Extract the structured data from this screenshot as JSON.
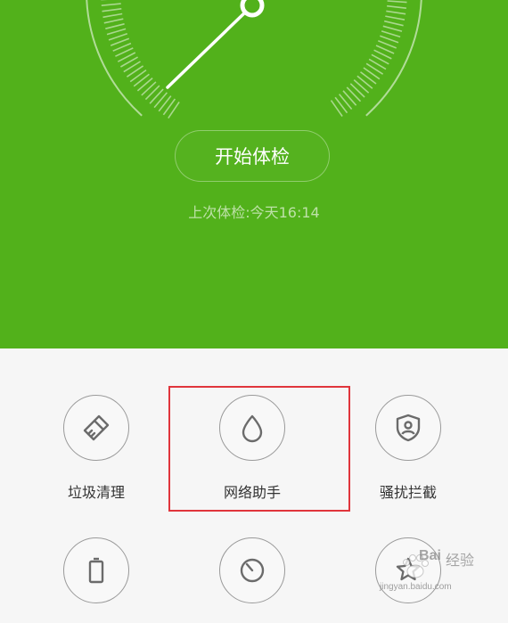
{
  "health_check": {
    "start_button_label": "开始体检",
    "last_check_text": "上次体检:今天16:14"
  },
  "colors": {
    "hero_green": "#52b11b",
    "highlight_red": "#e0353c",
    "tool_icon_gray": "#6b6b6b"
  },
  "tools": [
    {
      "label": "垃圾清理",
      "icon": "broom-icon"
    },
    {
      "label": "网络助手",
      "icon": "droplet-icon"
    },
    {
      "label": "骚扰拦截",
      "icon": "shield-user-icon"
    },
    {
      "label": "",
      "icon": "battery-icon"
    },
    {
      "label": "",
      "icon": "timer-icon"
    },
    {
      "label": "",
      "icon": "star-icon"
    }
  ],
  "watermark": {
    "brand_text": "Bai",
    "brand_suffix": "经验",
    "url_text": "jingyan.baidu.com"
  }
}
